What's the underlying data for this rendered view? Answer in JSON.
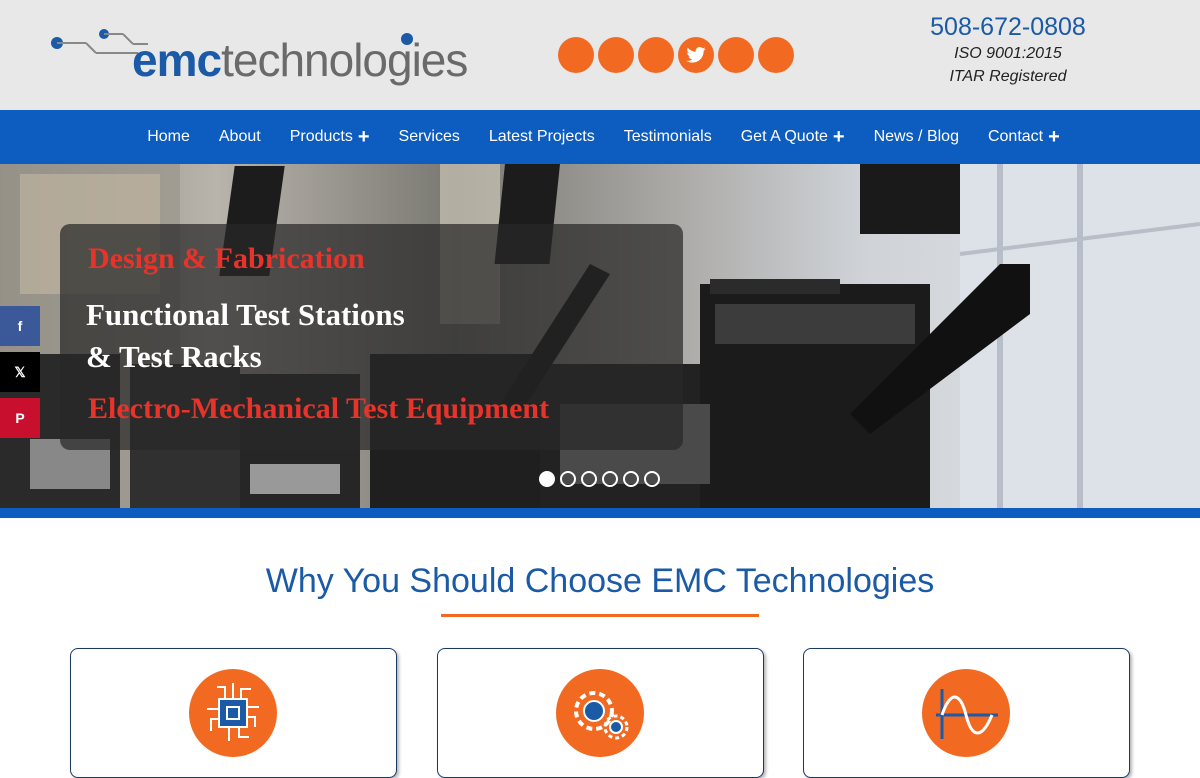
{
  "header": {
    "logo_emc": "emc",
    "logo_technologies": "technologies",
    "phone": "508-672-0808",
    "cert_iso": "ISO 9001:2015",
    "cert_itar": "ITAR Registered",
    "social_icons": [
      "blank",
      "blank",
      "blank",
      "twitter-icon",
      "blank",
      "blank"
    ]
  },
  "nav": {
    "items": [
      {
        "label": "Home",
        "has_submenu": false
      },
      {
        "label": "About",
        "has_submenu": false
      },
      {
        "label": "Products",
        "has_submenu": true
      },
      {
        "label": "Services",
        "has_submenu": false
      },
      {
        "label": "Latest Projects",
        "has_submenu": false
      },
      {
        "label": "Testimonials",
        "has_submenu": false
      },
      {
        "label": "Get A Quote",
        "has_submenu": true
      },
      {
        "label": "News / Blog",
        "has_submenu": false
      },
      {
        "label": "Contact",
        "has_submenu": true
      }
    ],
    "submenu_glyph": "+"
  },
  "hero": {
    "line1": "Design & Fabrication",
    "line2": "Functional Test Stations",
    "line3": "& Test Racks",
    "line4": "Electro-Mechanical Test Equipment",
    "slide_count": 6,
    "active_slide": 1
  },
  "share": {
    "facebook": "f",
    "x": "𝕏",
    "pinterest": "P"
  },
  "section": {
    "title": "Why You Should Choose EMC Technologies"
  },
  "colors": {
    "brand_blue": "#0d5cbf",
    "accent_orange": "#f26a21",
    "heading_red": "#e8332a"
  }
}
